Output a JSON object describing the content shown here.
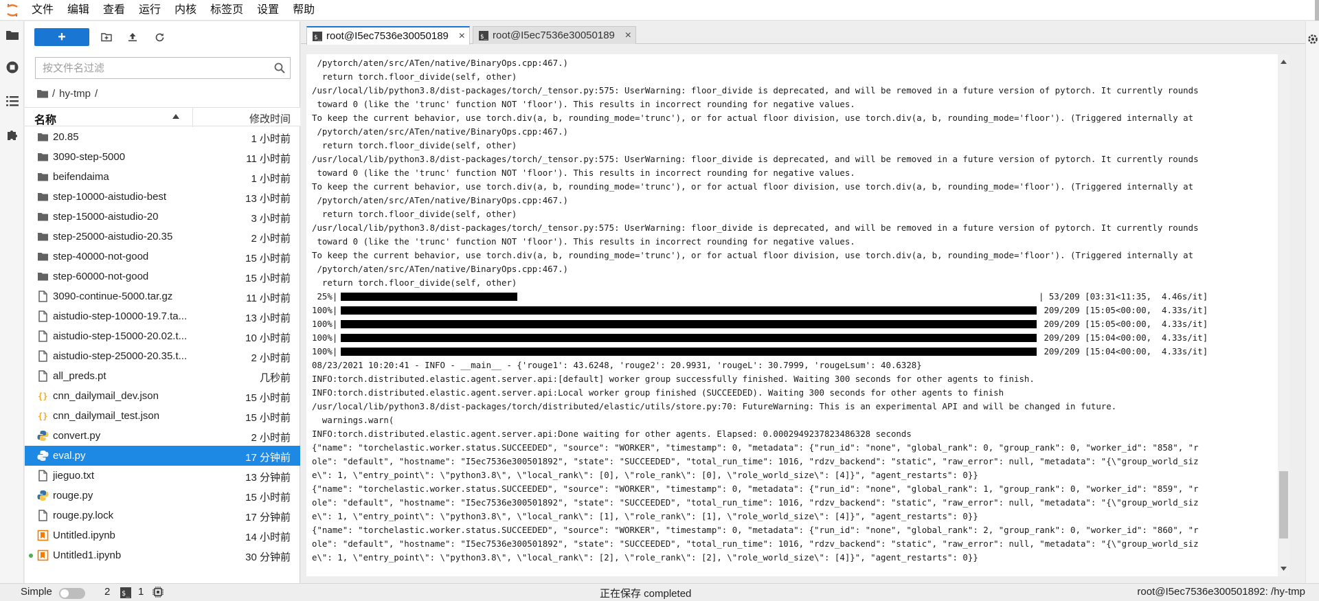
{
  "menubar": {
    "items": [
      "文件",
      "编辑",
      "查看",
      "运行",
      "内核",
      "标签页",
      "设置",
      "帮助"
    ]
  },
  "filebrowser": {
    "new_label": "+",
    "filter_placeholder": "按文件名过滤",
    "breadcrumb": {
      "sep1": "/",
      "folder": "hy-tmp",
      "sep2": "/"
    },
    "header": {
      "name": "名称",
      "modified": "修改时间"
    },
    "files": [
      {
        "name": "20.85",
        "time": "1 小时前",
        "type": "folder"
      },
      {
        "name": "3090-step-5000",
        "time": "11 小时前",
        "type": "folder"
      },
      {
        "name": "beifendaima",
        "time": "1 小时前",
        "type": "folder"
      },
      {
        "name": "step-10000-aistudio-best",
        "time": "13 小时前",
        "type": "folder"
      },
      {
        "name": "step-15000-aistudio-20",
        "time": "3 小时前",
        "type": "folder"
      },
      {
        "name": "step-25000-aistudio-20.35",
        "time": "2 小时前",
        "type": "folder"
      },
      {
        "name": "step-40000-not-good",
        "time": "15 小时前",
        "type": "folder"
      },
      {
        "name": "step-60000-not-good",
        "time": "15 小时前",
        "type": "folder"
      },
      {
        "name": "3090-continue-5000.tar.gz",
        "time": "11 小时前",
        "type": "file"
      },
      {
        "name": "aistudio-step-10000-19.7.ta...",
        "time": "13 小时前",
        "type": "file"
      },
      {
        "name": "aistudio-step-15000-20.02.t...",
        "time": "10 小时前",
        "type": "file"
      },
      {
        "name": "aistudio-step-25000-20.35.t...",
        "time": "2 小时前",
        "type": "file"
      },
      {
        "name": "all_preds.pt",
        "time": "几秒前",
        "type": "file"
      },
      {
        "name": "cnn_dailymail_dev.json",
        "time": "15 小时前",
        "type": "json"
      },
      {
        "name": "cnn_dailymail_test.json",
        "time": "15 小时前",
        "type": "json"
      },
      {
        "name": "convert.py",
        "time": "2 小时前",
        "type": "python"
      },
      {
        "name": "eval.py",
        "time": "17 分钟前",
        "type": "python",
        "selected": true
      },
      {
        "name": "jieguo.txt",
        "time": "13 分钟前",
        "type": "file"
      },
      {
        "name": "rouge.py",
        "time": "15 小时前",
        "type": "python"
      },
      {
        "name": "rouge.py.lock",
        "time": "17 分钟前",
        "type": "file"
      },
      {
        "name": "Untitled.ipynb",
        "time": "14 小时前",
        "type": "notebook"
      },
      {
        "name": "Untitled1.ipynb",
        "time": "30 分钟前",
        "type": "notebook",
        "running": true
      }
    ]
  },
  "tabs": [
    {
      "label": "root@I5ec7536e30050189",
      "active": true
    },
    {
      "label": "root@I5ec7536e30050189",
      "active": false
    }
  ],
  "terminal": {
    "lines_before": [
      " /pytorch/aten/src/ATen/native/BinaryOps.cpp:467.)",
      "  return torch.floor_divide(self, other)",
      "/usr/local/lib/python3.8/dist-packages/torch/_tensor.py:575: UserWarning: floor_divide is deprecated, and will be removed in a future version of pytorch. It currently rounds",
      " toward 0 (like the 'trunc' function NOT 'floor'). This results in incorrect rounding for negative values.",
      "To keep the current behavior, use torch.div(a, b, rounding_mode='trunc'), or for actual floor division, use torch.div(a, b, rounding_mode='floor'). (Triggered internally at",
      " /pytorch/aten/src/ATen/native/BinaryOps.cpp:467.)",
      "  return torch.floor_divide(self, other)",
      "/usr/local/lib/python3.8/dist-packages/torch/_tensor.py:575: UserWarning: floor_divide is deprecated, and will be removed in a future version of pytorch. It currently rounds",
      " toward 0 (like the 'trunc' function NOT 'floor'). This results in incorrect rounding for negative values.",
      "To keep the current behavior, use torch.div(a, b, rounding_mode='trunc'), or for actual floor division, use torch.div(a, b, rounding_mode='floor'). (Triggered internally at",
      " /pytorch/aten/src/ATen/native/BinaryOps.cpp:467.)",
      "  return torch.floor_divide(self, other)",
      "/usr/local/lib/python3.8/dist-packages/torch/_tensor.py:575: UserWarning: floor_divide is deprecated, and will be removed in a future version of pytorch. It currently rounds",
      " toward 0 (like the 'trunc' function NOT 'floor'). This results in incorrect rounding for negative values.",
      "To keep the current behavior, use torch.div(a, b, rounding_mode='trunc'), or for actual floor division, use torch.div(a, b, rounding_mode='floor'). (Triggered internally at",
      " /pytorch/aten/src/ATen/native/BinaryOps.cpp:467.)",
      "  return torch.floor_divide(self, other)"
    ],
    "progress": [
      {
        "pct": " 25%|",
        "fraction": 0.2536,
        "stats": "| 53/209 [03:31<11:35,  4.46s/it]"
      },
      {
        "pct": "100%|",
        "fraction": 1.0,
        "stats": " 209/209 [15:05<00:00,  4.33s/it]"
      },
      {
        "pct": "100%|",
        "fraction": 1.0,
        "stats": " 209/209 [15:05<00:00,  4.33s/it]"
      },
      {
        "pct": "100%|",
        "fraction": 1.0,
        "stats": " 209/209 [15:04<00:00,  4.33s/it]"
      },
      {
        "pct": "100%|",
        "fraction": 1.0,
        "stats": " 209/209 [15:04<00:00,  4.33s/it]"
      }
    ],
    "lines_after": [
      "08/23/2021 10:20:41 - INFO - __main__ - {'rouge1': 43.6248, 'rouge2': 20.9931, 'rougeL': 30.7999, 'rougeLsum': 40.6328}",
      "INFO:torch.distributed.elastic.agent.server.api:[default] worker group successfully finished. Waiting 300 seconds for other agents to finish.",
      "INFO:torch.distributed.elastic.agent.server.api:Local worker group finished (SUCCEEDED). Waiting 300 seconds for other agents to finish",
      "/usr/local/lib/python3.8/dist-packages/torch/distributed/elastic/utils/store.py:70: FutureWarning: This is an experimental API and will be changed in future.",
      "  warnings.warn(",
      "INFO:torch.distributed.elastic.agent.server.api:Done waiting for other agents. Elapsed: 0.0002949237823486328 seconds",
      "{\"name\": \"torchelastic.worker.status.SUCCEEDED\", \"source\": \"WORKER\", \"timestamp\": 0, \"metadata\": {\"run_id\": \"none\", \"global_rank\": 0, \"group_rank\": 0, \"worker_id\": \"858\", \"r",
      "ole\": \"default\", \"hostname\": \"I5ec7536e300501892\", \"state\": \"SUCCEEDED\", \"total_run_time\": 1016, \"rdzv_backend\": \"static\", \"raw_error\": null, \"metadata\": \"{\\\"group_world_siz",
      "e\\\": 1, \\\"entry_point\\\": \\\"python3.8\\\", \\\"local_rank\\\": [0], \\\"role_rank\\\": [0], \\\"role_world_size\\\": [4]}\", \"agent_restarts\": 0}}",
      "{\"name\": \"torchelastic.worker.status.SUCCEEDED\", \"source\": \"WORKER\", \"timestamp\": 0, \"metadata\": {\"run_id\": \"none\", \"global_rank\": 1, \"group_rank\": 0, \"worker_id\": \"859\", \"r",
      "ole\": \"default\", \"hostname\": \"I5ec7536e300501892\", \"state\": \"SUCCEEDED\", \"total_run_time\": 1016, \"rdzv_backend\": \"static\", \"raw_error\": null, \"metadata\": \"{\\\"group_world_siz",
      "e\\\": 1, \\\"entry_point\\\": \\\"python3.8\\\", \\\"local_rank\\\": [1], \\\"role_rank\\\": [1], \\\"role_world_size\\\": [4]}\", \"agent_restarts\": 0}}",
      "{\"name\": \"torchelastic.worker.status.SUCCEEDED\", \"source\": \"WORKER\", \"timestamp\": 0, \"metadata\": {\"run_id\": \"none\", \"global_rank\": 2, \"group_rank\": 0, \"worker_id\": \"860\", \"r",
      "ole\": \"default\", \"hostname\": \"I5ec7536e300501892\", \"state\": \"SUCCEEDED\", \"total_run_time\": 1016, \"rdzv_backend\": \"static\", \"raw_error\": null, \"metadata\": \"{\\\"group_world_siz",
      "e\\\": 1, \\\"entry_point\\\": \\\"python3.8\\\", \\\"local_rank\\\": [2], \\\"role_rank\\\": [2], \\\"role_world_size\\\": [4]}\", \"agent_restarts\": 0}}"
    ]
  },
  "statusbar": {
    "mode_label": "Simple",
    "kernels_count": "2",
    "terminals_count": "1",
    "save_status": "正在保存 completed",
    "path": "root@I5ec7536e300501892: /hy-tmp"
  },
  "colors": {
    "accent": "#1976d2",
    "selected_row": "#1e88e5",
    "notebook_icon": "#f57c00",
    "json_icon": "#f9a825",
    "python_icon": "#3572a5",
    "running_dot": "#4caf50"
  }
}
